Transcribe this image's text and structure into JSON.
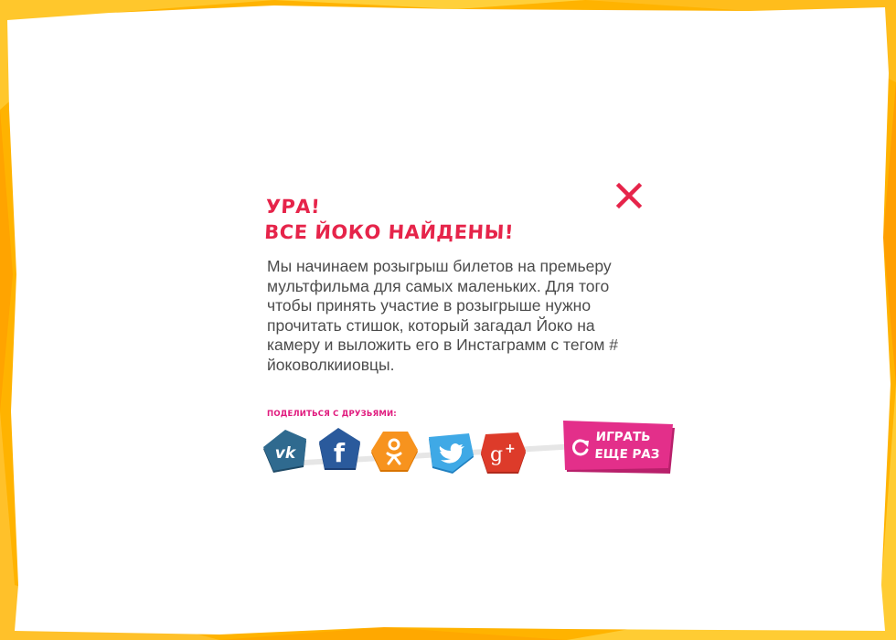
{
  "dialog": {
    "title_line1": "УРА!",
    "title_line2": "ВСЕ ЙОКО НАЙДЕНЫ!",
    "description": "Мы начинаем розыгрыш билетов на премьеру мультфильма для самых маленьких. Для того чтобы принять участие в розыгрыше нужно прочитать стишок, который загадал Йоко на камеру и выложить его в Инстаграмм с тегом # йоковолкииовцы.",
    "share_label": "ПОДЕЛИТЬСЯ С ДРУЗЬЯМИ:",
    "play_again_line1": "ИГРАТЬ",
    "play_again_line2": "ЕЩЕ РАЗ"
  },
  "share_buttons": [
    {
      "network": "vk",
      "icon": "vk-icon",
      "color": "#2f5f7f"
    },
    {
      "network": "facebook",
      "icon": "facebook-icon",
      "color": "#2a5a9c"
    },
    {
      "network": "odnoklassniki",
      "icon": "odnoklassniki-icon",
      "color": "#f7931e"
    },
    {
      "network": "twitter",
      "icon": "twitter-icon",
      "color": "#3fa9e6"
    },
    {
      "network": "google-plus",
      "icon": "google-plus-icon",
      "color": "#dd3b2a"
    }
  ],
  "colors": {
    "accent_red": "#e6244a",
    "share_label": "#e0197d",
    "play_button": "#e32f8a",
    "frame": "#ffb400"
  }
}
